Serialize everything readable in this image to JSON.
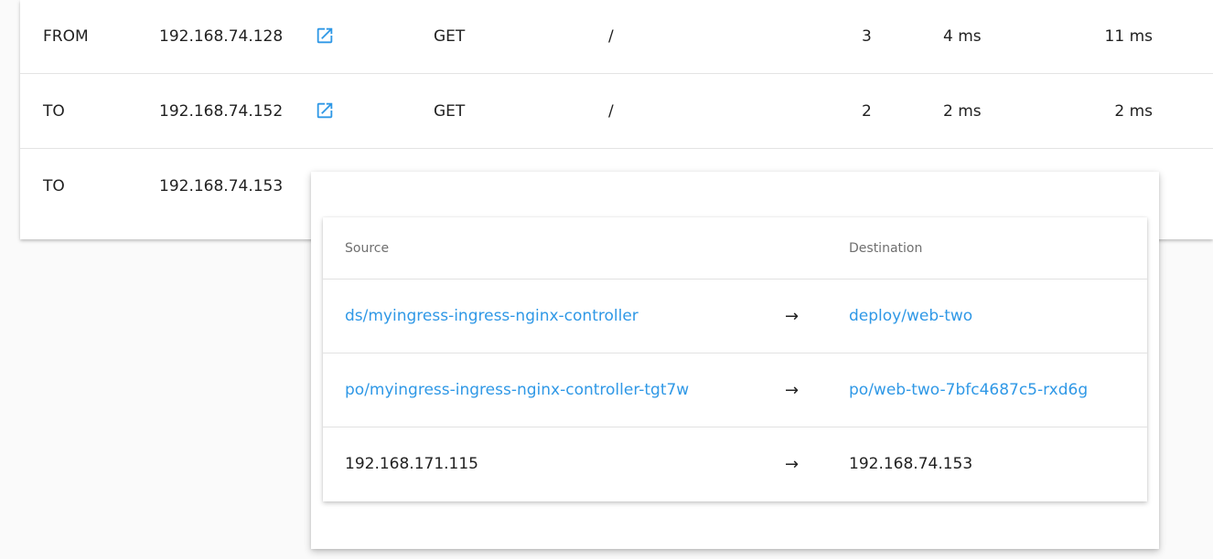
{
  "traffic_table": {
    "rows": [
      {
        "direction": "FROM",
        "ip": "192.168.74.128",
        "method": "GET",
        "path": "/",
        "count": "3",
        "latency_a": "4 ms",
        "latency_b": "11 ms"
      },
      {
        "direction": "TO",
        "ip": "192.168.74.152",
        "method": "GET",
        "path": "/",
        "count": "2",
        "latency_a": "2 ms",
        "latency_b": "2 ms"
      },
      {
        "direction": "TO",
        "ip": "192.168.74.153"
      }
    ]
  },
  "popover": {
    "headers": {
      "source": "Source",
      "destination": "Destination"
    },
    "rows": [
      {
        "source": "ds/myingress-ingress-nginx-controller",
        "arrow": "→",
        "destination": "deploy/web-two"
      },
      {
        "source": "po/myingress-ingress-nginx-controller-tgt7w",
        "arrow": "→",
        "destination": "po/web-two-7bfc4687c5-rxd6g"
      },
      {
        "source": "192.168.171.115",
        "arrow": "→",
        "destination": "192.168.74.153"
      }
    ]
  },
  "colors": {
    "link": "#2f98e6",
    "text": "#212121",
    "muted": "#6f6f6f"
  },
  "icons": {
    "external_link": "external-link-icon",
    "arrow": "right-arrow-icon"
  }
}
